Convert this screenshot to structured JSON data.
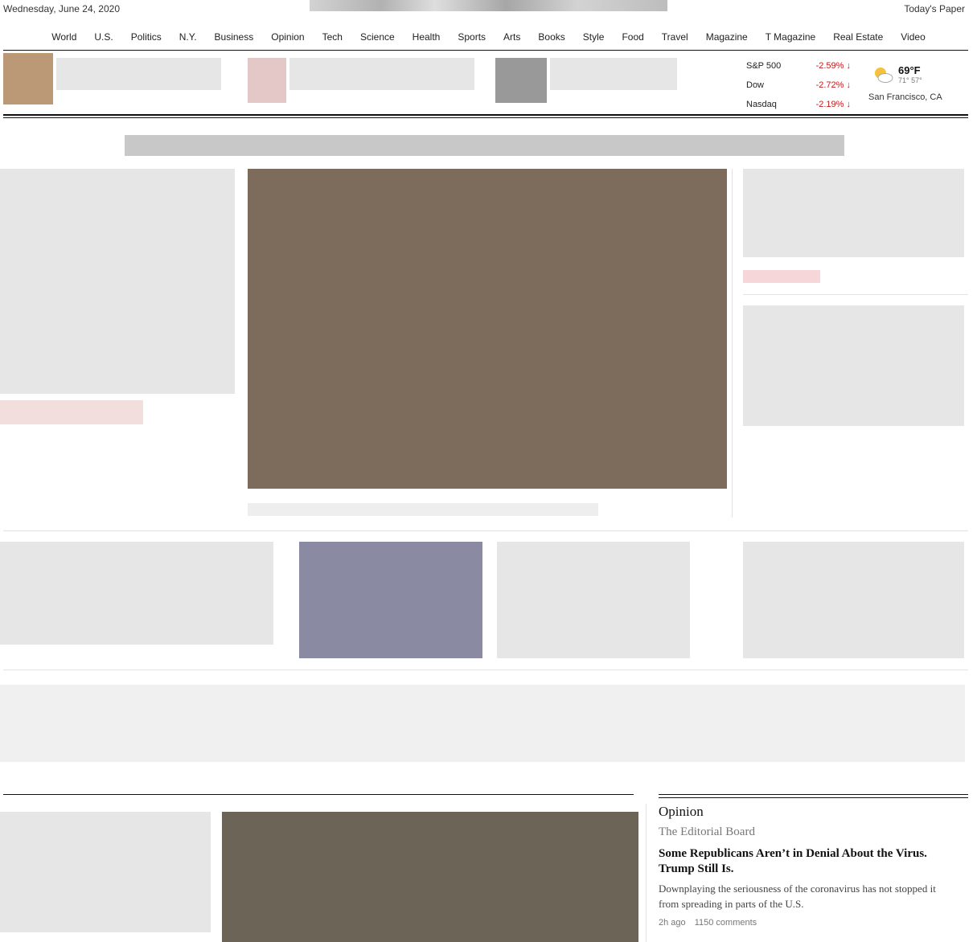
{
  "top": {
    "date": "Wednesday, June 24, 2020",
    "todays_paper": "Today's Paper"
  },
  "nav": {
    "items": [
      "World",
      "U.S.",
      "Politics",
      "N.Y.",
      "Business",
      "Opinion",
      "Tech",
      "Science",
      "Health",
      "Sports",
      "Arts",
      "Books",
      "Style",
      "Food",
      "Travel",
      "Magazine",
      "T Magazine",
      "Real Estate",
      "Video"
    ]
  },
  "markets": [
    {
      "name": "S&P 500",
      "change": "-2.59%",
      "arrow": "↓"
    },
    {
      "name": "Dow",
      "change": "-2.72%",
      "arrow": "↓"
    },
    {
      "name": "Nasdaq",
      "change": "-2.19%",
      "arrow": "↓"
    }
  ],
  "weather": {
    "icon": "partly-cloudy-icon",
    "temp": "69°F",
    "hi": "71°",
    "lo": "57°",
    "location": "San Francisco, CA"
  },
  "opinion": {
    "section": "Opinion",
    "author": "The Editorial Board",
    "headline": "Some Republicans Aren’t in Denial About the Virus. Trump Still Is.",
    "summary": "Downplaying the seriousness of the coronavirus has not stopped it from spreading in parts of the U.S.",
    "time": "2h ago",
    "comments": "1150 comments"
  },
  "colors": {
    "accent_red": "#c41a1a",
    "rule": "#121212"
  }
}
